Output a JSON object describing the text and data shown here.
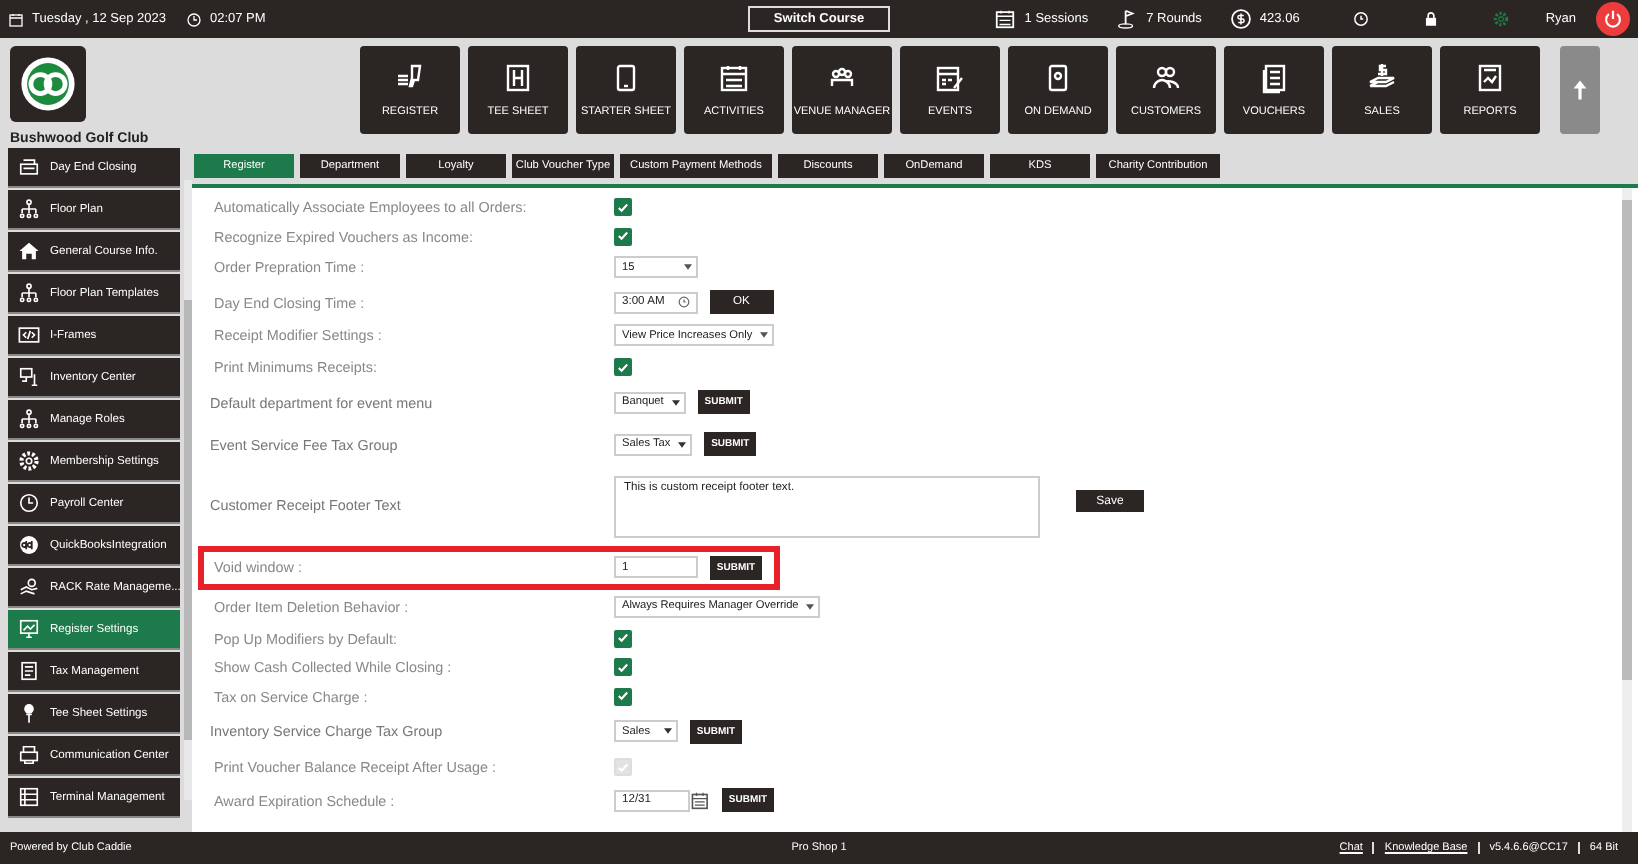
{
  "top_bar": {
    "date": "Tuesday , 12 Sep 2023",
    "time": "02:07 PM",
    "switch_button": "Switch Course",
    "sessions": "1 Sessions",
    "rounds": "7 Rounds",
    "balance": "423.06",
    "user": "Ryan"
  },
  "club_name": "Bushwood Golf Club",
  "nav_buttons": [
    "REGISTER",
    "TEE SHEET",
    "STARTER SHEET",
    "ACTIVITIES",
    "VENUE MANAGER",
    "EVENTS",
    "ON DEMAND",
    "CUSTOMERS",
    "VOUCHERS",
    "SALES",
    "REPORTS"
  ],
  "sidebar": {
    "items": [
      {
        "label": "Day End Closing",
        "selected": false
      },
      {
        "label": "Floor Plan",
        "selected": false
      },
      {
        "label": "General Course Info.",
        "selected": false
      },
      {
        "label": "Floor Plan Templates",
        "selected": false
      },
      {
        "label": "I-Frames",
        "selected": false
      },
      {
        "label": "Inventory Center",
        "selected": false
      },
      {
        "label": "Manage Roles",
        "selected": false
      },
      {
        "label": "Membership Settings",
        "selected": false
      },
      {
        "label": "Payroll Center",
        "selected": false
      },
      {
        "label": "QuickBooksIntegration",
        "selected": false
      },
      {
        "label": "RACK Rate Manageme...",
        "selected": false
      },
      {
        "label": "Register Settings",
        "selected": true
      },
      {
        "label": "Tax Management",
        "selected": false
      },
      {
        "label": "Tee Sheet Settings",
        "selected": false
      },
      {
        "label": "Communication Center",
        "selected": false
      },
      {
        "label": "Terminal Management",
        "selected": false
      }
    ]
  },
  "tabs": [
    {
      "label": "Register",
      "selected": true
    },
    {
      "label": "Department",
      "selected": false
    },
    {
      "label": "Loyalty",
      "selected": false
    },
    {
      "label": "Club Voucher Type",
      "selected": false
    },
    {
      "label": "Custom Payment Methods",
      "selected": false
    },
    {
      "label": "Discounts",
      "selected": false
    },
    {
      "label": "OnDemand",
      "selected": false
    },
    {
      "label": "KDS",
      "selected": false
    },
    {
      "label": "Charity Contribution",
      "selected": false
    }
  ],
  "settings": [
    {
      "kind": "checkbox",
      "label": "Automatically Associate Employees to all Orders:",
      "checked": true,
      "disabled": false,
      "highlighted": false
    },
    {
      "kind": "checkbox",
      "label": "Recognize Expired Vouchers as Income:",
      "checked": true,
      "disabled": false,
      "highlighted": false
    },
    {
      "kind": "select",
      "label": "Order Prepration Time :",
      "value": "15",
      "highlighted": false
    },
    {
      "kind": "time",
      "label": "Day End Closing Time :",
      "value": "3:00 AM",
      "button": "OK",
      "highlighted": false
    },
    {
      "kind": "select",
      "label": "Receipt Modifier Settings :",
      "value": "View Price Increases Only",
      "highlighted": false
    },
    {
      "kind": "checkbox",
      "label": "Print Minimums Receipts:",
      "checked": true,
      "disabled": false,
      "highlighted": false
    },
    {
      "kind": "select_submit",
      "label": "Default department for event menu",
      "value": "Banquet",
      "button": "SUBMIT",
      "highlighted": false
    },
    {
      "kind": "select_submit",
      "label": "Event Service Fee Tax Group",
      "value": "Sales Tax",
      "button": "SUBMIT",
      "highlighted": false
    },
    {
      "kind": "textarea",
      "label": "Customer Receipt Footer Text",
      "value": "This is custom receipt footer text.",
      "button": "Save",
      "highlighted": false
    },
    {
      "kind": "input_submit",
      "label": "Void window :",
      "value": "1",
      "button": "SUBMIT",
      "highlighted": true
    },
    {
      "kind": "select",
      "label": "Order Item Deletion Behavior :",
      "value": "Always Requires Manager Override",
      "highlighted": false
    },
    {
      "kind": "checkbox",
      "label": "Pop Up Modifiers by Default:",
      "checked": true,
      "disabled": false,
      "highlighted": false
    },
    {
      "kind": "checkbox",
      "label": "Show Cash Collected While Closing :",
      "checked": true,
      "disabled": false,
      "highlighted": false
    },
    {
      "kind": "checkbox",
      "label": "Tax on Service Charge :",
      "checked": true,
      "disabled": false,
      "highlighted": false
    },
    {
      "kind": "select_submit",
      "label": "Inventory Service Charge Tax Group",
      "value": "Sales",
      "button": "SUBMIT",
      "highlighted": false
    },
    {
      "kind": "checkbox",
      "label": "Print Voucher Balance Receipt After Usage :",
      "checked": true,
      "disabled": true,
      "highlighted": false
    },
    {
      "kind": "date_submit",
      "label": "Award Expiration Schedule :",
      "value": "12/31",
      "button": "SUBMIT",
      "highlighted": false
    }
  ],
  "footer": {
    "powered_by": "Powered by Club Caddie",
    "terminal": "Pro Shop 1",
    "links": [
      {
        "kind": "link",
        "text": "Chat"
      },
      {
        "kind": "link",
        "text": "Knowledge Base"
      },
      {
        "kind": "text",
        "text": "v5.4.6.6@CC17"
      },
      {
        "kind": "text",
        "text": "64 Bit"
      }
    ]
  }
}
